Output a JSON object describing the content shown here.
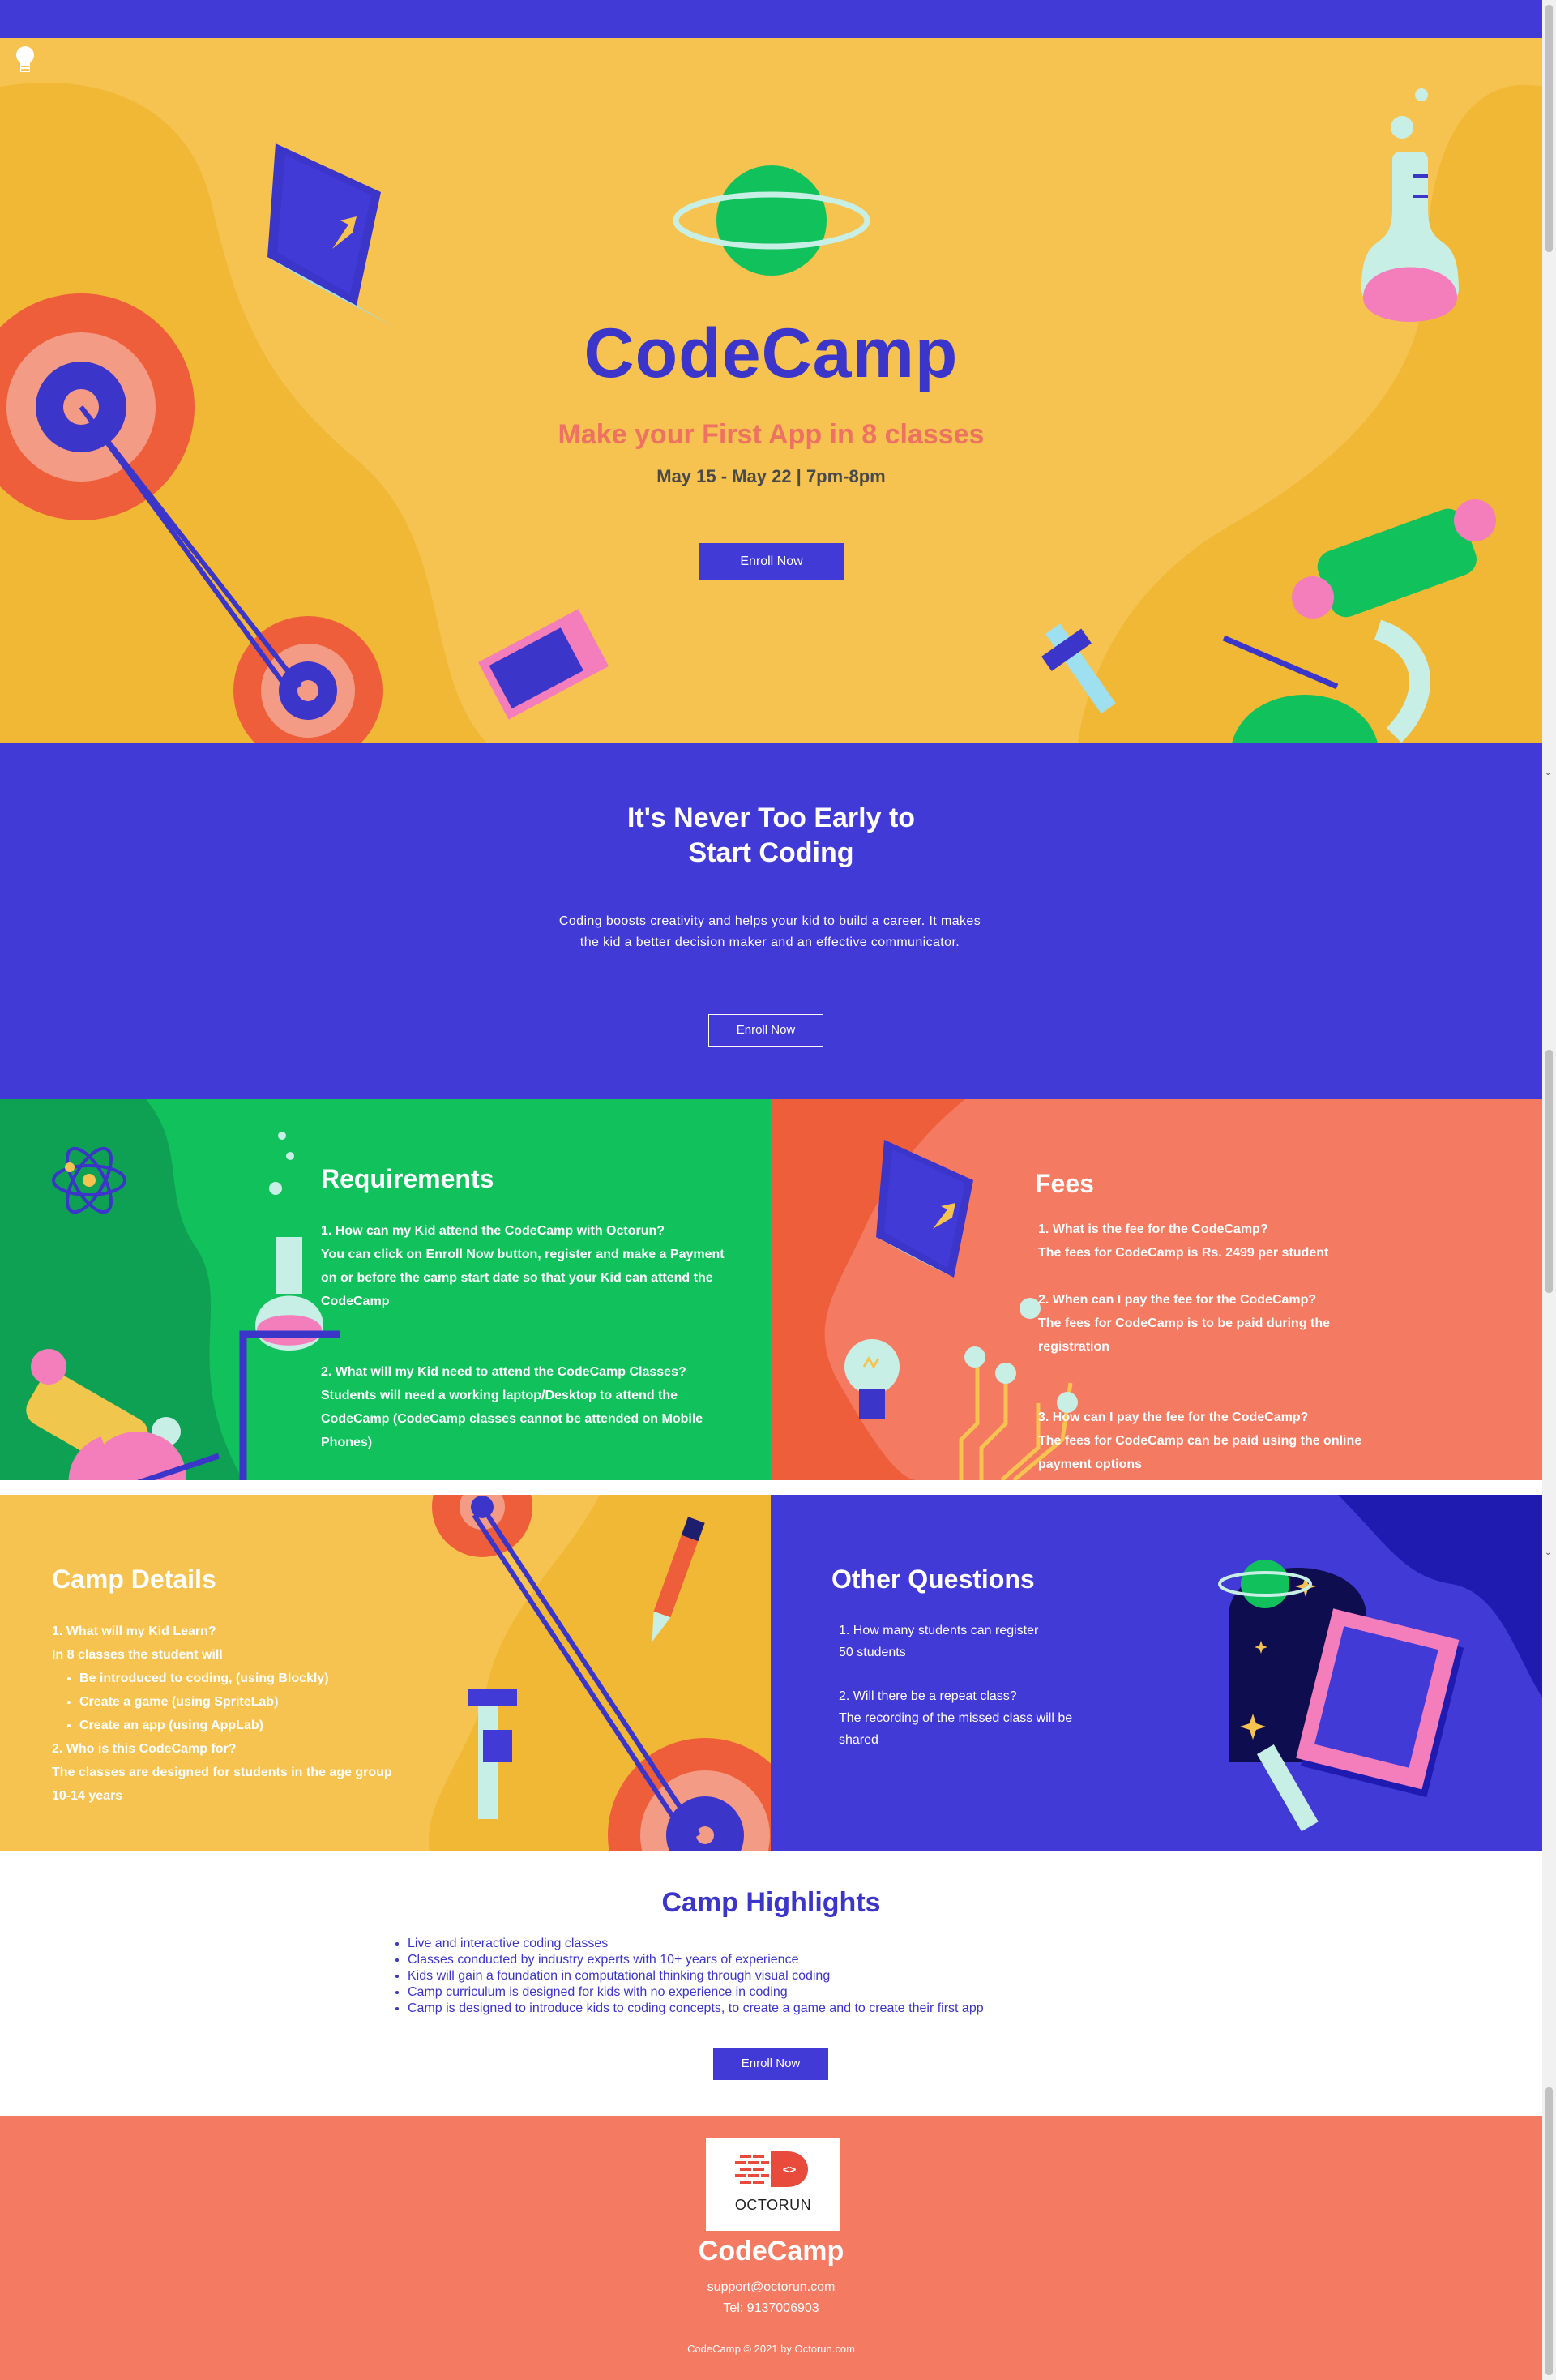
{
  "colors": {
    "primary_blue": "#423ad7",
    "hero_yellow": "#f6c350",
    "green": "#10c15c",
    "coral": "#f47a62"
  },
  "hero": {
    "title": "CodeCamp",
    "subtitle": "Make your First App in 8 classes",
    "date_line": "May 15 - May 22 |  7pm-8pm",
    "cta_label": "Enroll Now"
  },
  "intro": {
    "title_line1": "It's Never Too Early to",
    "title_line2": "Start Coding",
    "text": "Coding boosts creativity and helps your kid to build a career. It makes the kid a better decision maker and an effective communicator.",
    "cta_label": "Enroll Now"
  },
  "requirements": {
    "title": "Requirements",
    "q1": "1. How can my Kid attend the CodeCamp with Octorun?",
    "a1": "You can click on Enroll Now button, register and make a Payment on or before the camp start date so that your Kid can attend the CodeCamp",
    "q2": "2. What will my Kid need to attend the CodeCamp Classes?",
    "a2": "Students will need a working laptop/Desktop to attend the CodeCamp (CodeCamp classes cannot be attended on Mobile Phones)"
  },
  "fees": {
    "title": "Fees",
    "q1": "1. What is the fee for the CodeCamp?",
    "a1": "The fees for CodeCamp is Rs. 2499 per student",
    "q2": "2. When can I pay the fee for the CodeCamp?",
    "a2": "The fees for CodeCamp is to be paid during the registration",
    "q3": "3. How can I pay the fee for the CodeCamp?",
    "a3": "The fees for CodeCamp can be paid using the online payment options"
  },
  "camp_details": {
    "title": "Camp Details",
    "q1": "1. What will my Kid Learn?",
    "a1": "In 8 classes the student will",
    "learn_items": [
      "Be introduced to coding, (using Blockly)",
      "Create a game (using SpriteLab)",
      "Create an app (using AppLab)"
    ],
    "q2": "2. Who is this CodeCamp for?",
    "a2": "The classes are designed for students in the age group 10-14 years"
  },
  "other_questions": {
    "title": "Other Questions",
    "q1": "1. How many students can register",
    "a1": "50 students",
    "q2": "2. Will there be a repeat class?",
    "a2": "The recording of the missed class will be shared"
  },
  "highlights": {
    "title": "Camp Highlights",
    "items": [
      "Live and interactive coding classes",
      "Classes conducted by industry experts with 10+ years of experience",
      "Kids will gain a foundation in computational thinking through visual coding",
      "Camp curriculum is designed for kids with no experience in coding",
      "Camp is designed to introduce kids to coding concepts, to create a game and to create their first app"
    ],
    "cta_label": "Enroll Now"
  },
  "footer": {
    "logo_text": "OCTORUN",
    "name": "CodeCamp",
    "email": "support@octorun.com",
    "tel": "Tel: 9137006903",
    "copyright": "CodeCamp © 2021 by Octorun.com"
  }
}
